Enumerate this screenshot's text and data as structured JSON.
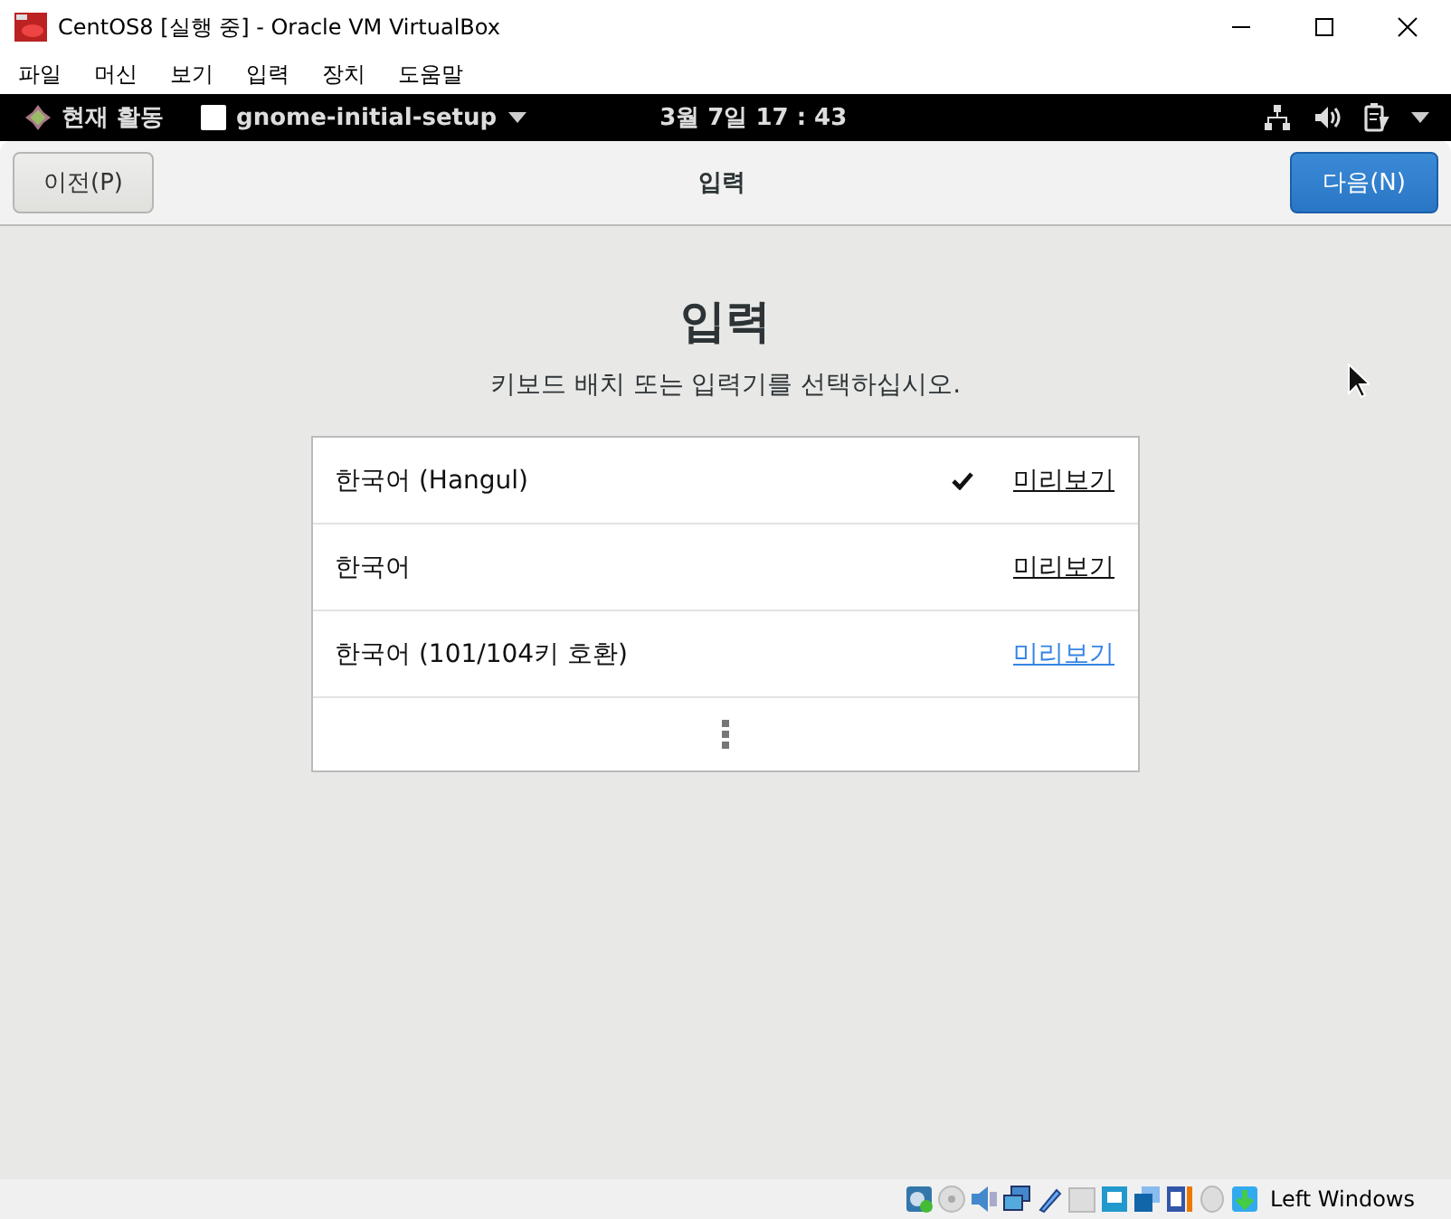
{
  "window": {
    "title": "CentOS8 [실행 중] - Oracle VM VirtualBox"
  },
  "menu": [
    "파일",
    "머신",
    "보기",
    "입력",
    "장치",
    "도움말"
  ],
  "topbar": {
    "activities": "현재 활동",
    "app_name": "gnome-initial-setup",
    "clock": "3월 7일  17 : 43"
  },
  "header": {
    "back": "이전(P)",
    "title": "입력",
    "next": "다음(N)"
  },
  "page": {
    "heading": "입력",
    "subtitle": "키보드 배치 또는 입력기를 선택하십시오."
  },
  "layouts": [
    {
      "name": "한국어 (Hangul)",
      "checked": true,
      "preview": "미리보기",
      "hovered": false
    },
    {
      "name": "한국어",
      "checked": false,
      "preview": "미리보기",
      "hovered": false
    },
    {
      "name": "한국어 (101/104키 호환)",
      "checked": false,
      "preview": "미리보기",
      "hovered": true
    }
  ],
  "status_bar": {
    "host_key": "Left Windows"
  }
}
